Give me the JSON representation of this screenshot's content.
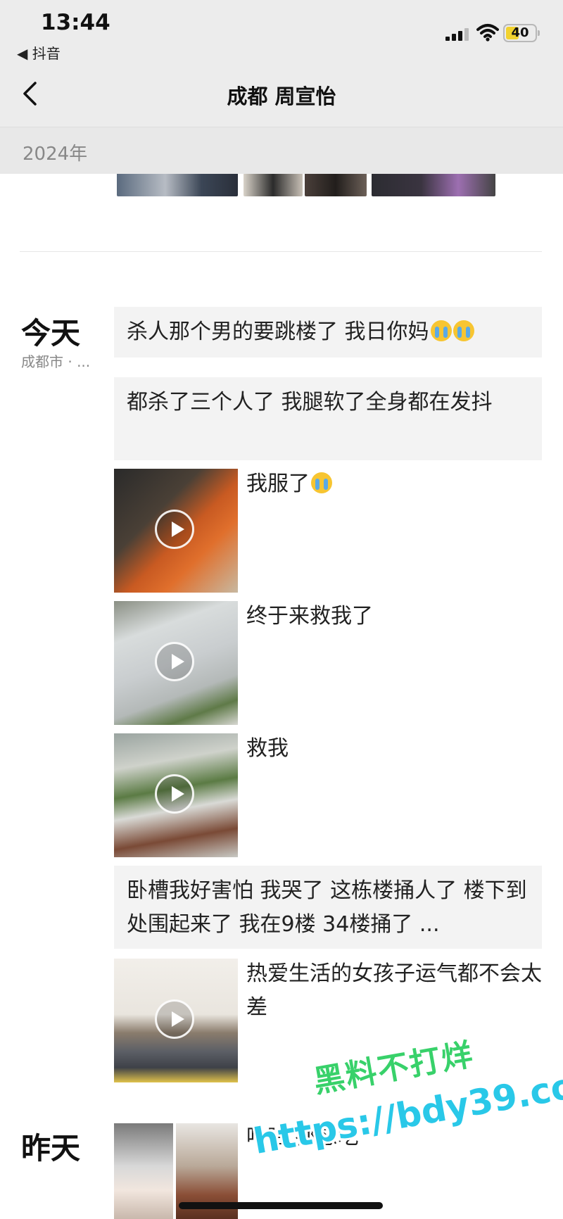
{
  "status_bar": {
    "time": "13:44",
    "back_app": "◀ 抖音",
    "battery": "40"
  },
  "nav": {
    "title": "成都 周宣怡"
  },
  "year_header": "2024年",
  "days": [
    {
      "label": "今天",
      "location": "成都市 · ..."
    },
    {
      "label": "昨天"
    }
  ],
  "posts": [
    {
      "type": "text",
      "text": "杀人那个男的要跳楼了 我日你妈",
      "emoji_count": 2
    },
    {
      "type": "text",
      "text": "都杀了三个人了 我腿软了全身都在发抖"
    },
    {
      "type": "video",
      "caption": "我服了",
      "emoji_count": 1
    },
    {
      "type": "video",
      "caption": "终于来救我了"
    },
    {
      "type": "video",
      "caption": "救我"
    },
    {
      "type": "text",
      "text": "卧槽我好害怕 我哭了 这栋楼捅人了 楼下到处围起来了 我在9楼 34楼捅了 ..."
    },
    {
      "type": "video",
      "caption": "热爱生活的女孩子运气都不会太差"
    },
    {
      "type": "photo",
      "caption": "哈哈 都想吃"
    }
  ],
  "watermark": {
    "line1": "黑料不打烊",
    "line2": "https://bdy39.co"
  },
  "icons": [
    "back-arrow-icon",
    "signal-icon",
    "wifi-icon",
    "battery-icon",
    "chevron-left-icon",
    "play-icon",
    "crying-emoji-icon"
  ],
  "colors": {
    "header_bg": "#ececec",
    "bubble_bg": "#f3f3f3",
    "watermark_green": "#38d16a",
    "watermark_blue": "#29c8e8"
  }
}
